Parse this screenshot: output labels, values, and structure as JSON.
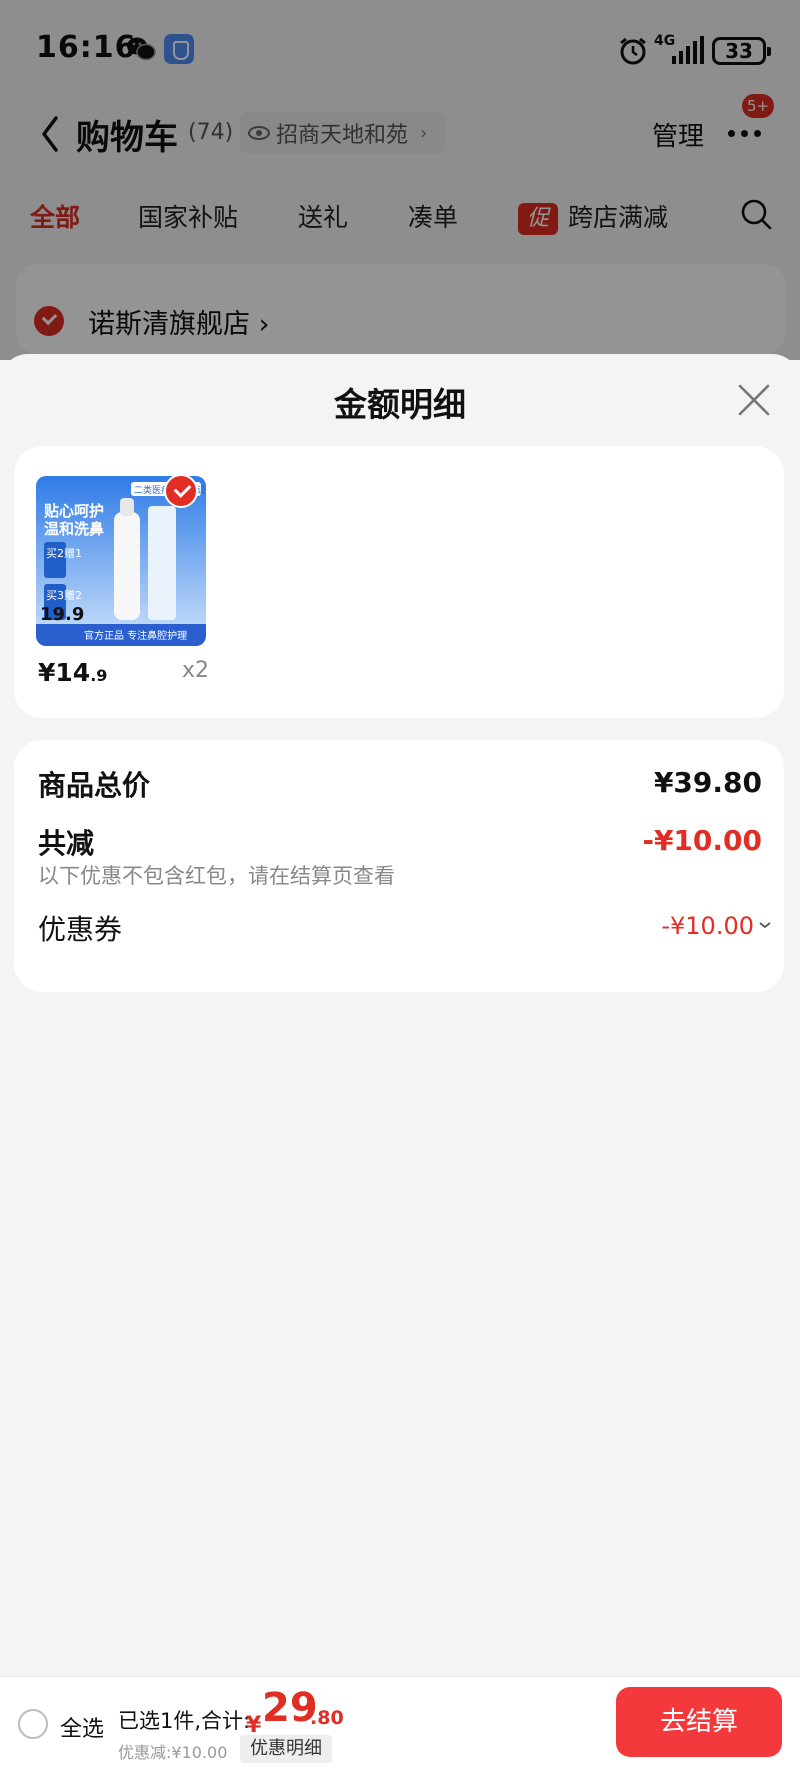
{
  "status_bar": {
    "time": "16:16",
    "network": "4G",
    "battery": "33"
  },
  "header": {
    "title": "购物车",
    "count": "(74)",
    "location": "招商天地和苑",
    "manage": "管理",
    "more_badge": "5+"
  },
  "tabs": [
    {
      "label": "全部"
    },
    {
      "label": "国家补贴"
    },
    {
      "label": "送礼"
    },
    {
      "label": "凑单"
    },
    {
      "label": "跨店满减",
      "tag": "促"
    }
  ],
  "store": {
    "name": "诺斯清旗舰店"
  },
  "sheet": {
    "title": "金额明细",
    "product": {
      "price_symbol": "¥",
      "price_int": "14",
      "price_dec": ".9",
      "quantity": "x2",
      "thumb_price": "19.9",
      "thumb_title_1": "贴心呵护",
      "thumb_title_2": "温和洗鼻",
      "thumb_footer": "官方正品 专注鼻腔护理",
      "thumb_badge": "二类医疗器械认证",
      "thumb_offer_1": "买2赠1",
      "thumb_offer_2": "买3赠2"
    },
    "summary": {
      "total_label": "商品总价",
      "total_value": "¥39.80",
      "reduce_label": "共减",
      "reduce_value": "-¥10.00",
      "reduce_note": "以下优惠不包含红包，请在结算页查看",
      "coupon_label": "优惠券",
      "coupon_value": "-¥10.00"
    }
  },
  "bottom_bar": {
    "select_all": "全选",
    "selected_text": "已选1件,合计:",
    "currency": "¥",
    "total_int": "29",
    "total_dec": ".80",
    "discount_text": "优惠减:¥10.00",
    "detail_label": "优惠明细",
    "checkout": "去结算"
  },
  "colors": {
    "accent_red": "#e02e24",
    "checkout_red": "#f4393d",
    "overlay": "rgba(0,0,0,0.42)"
  }
}
